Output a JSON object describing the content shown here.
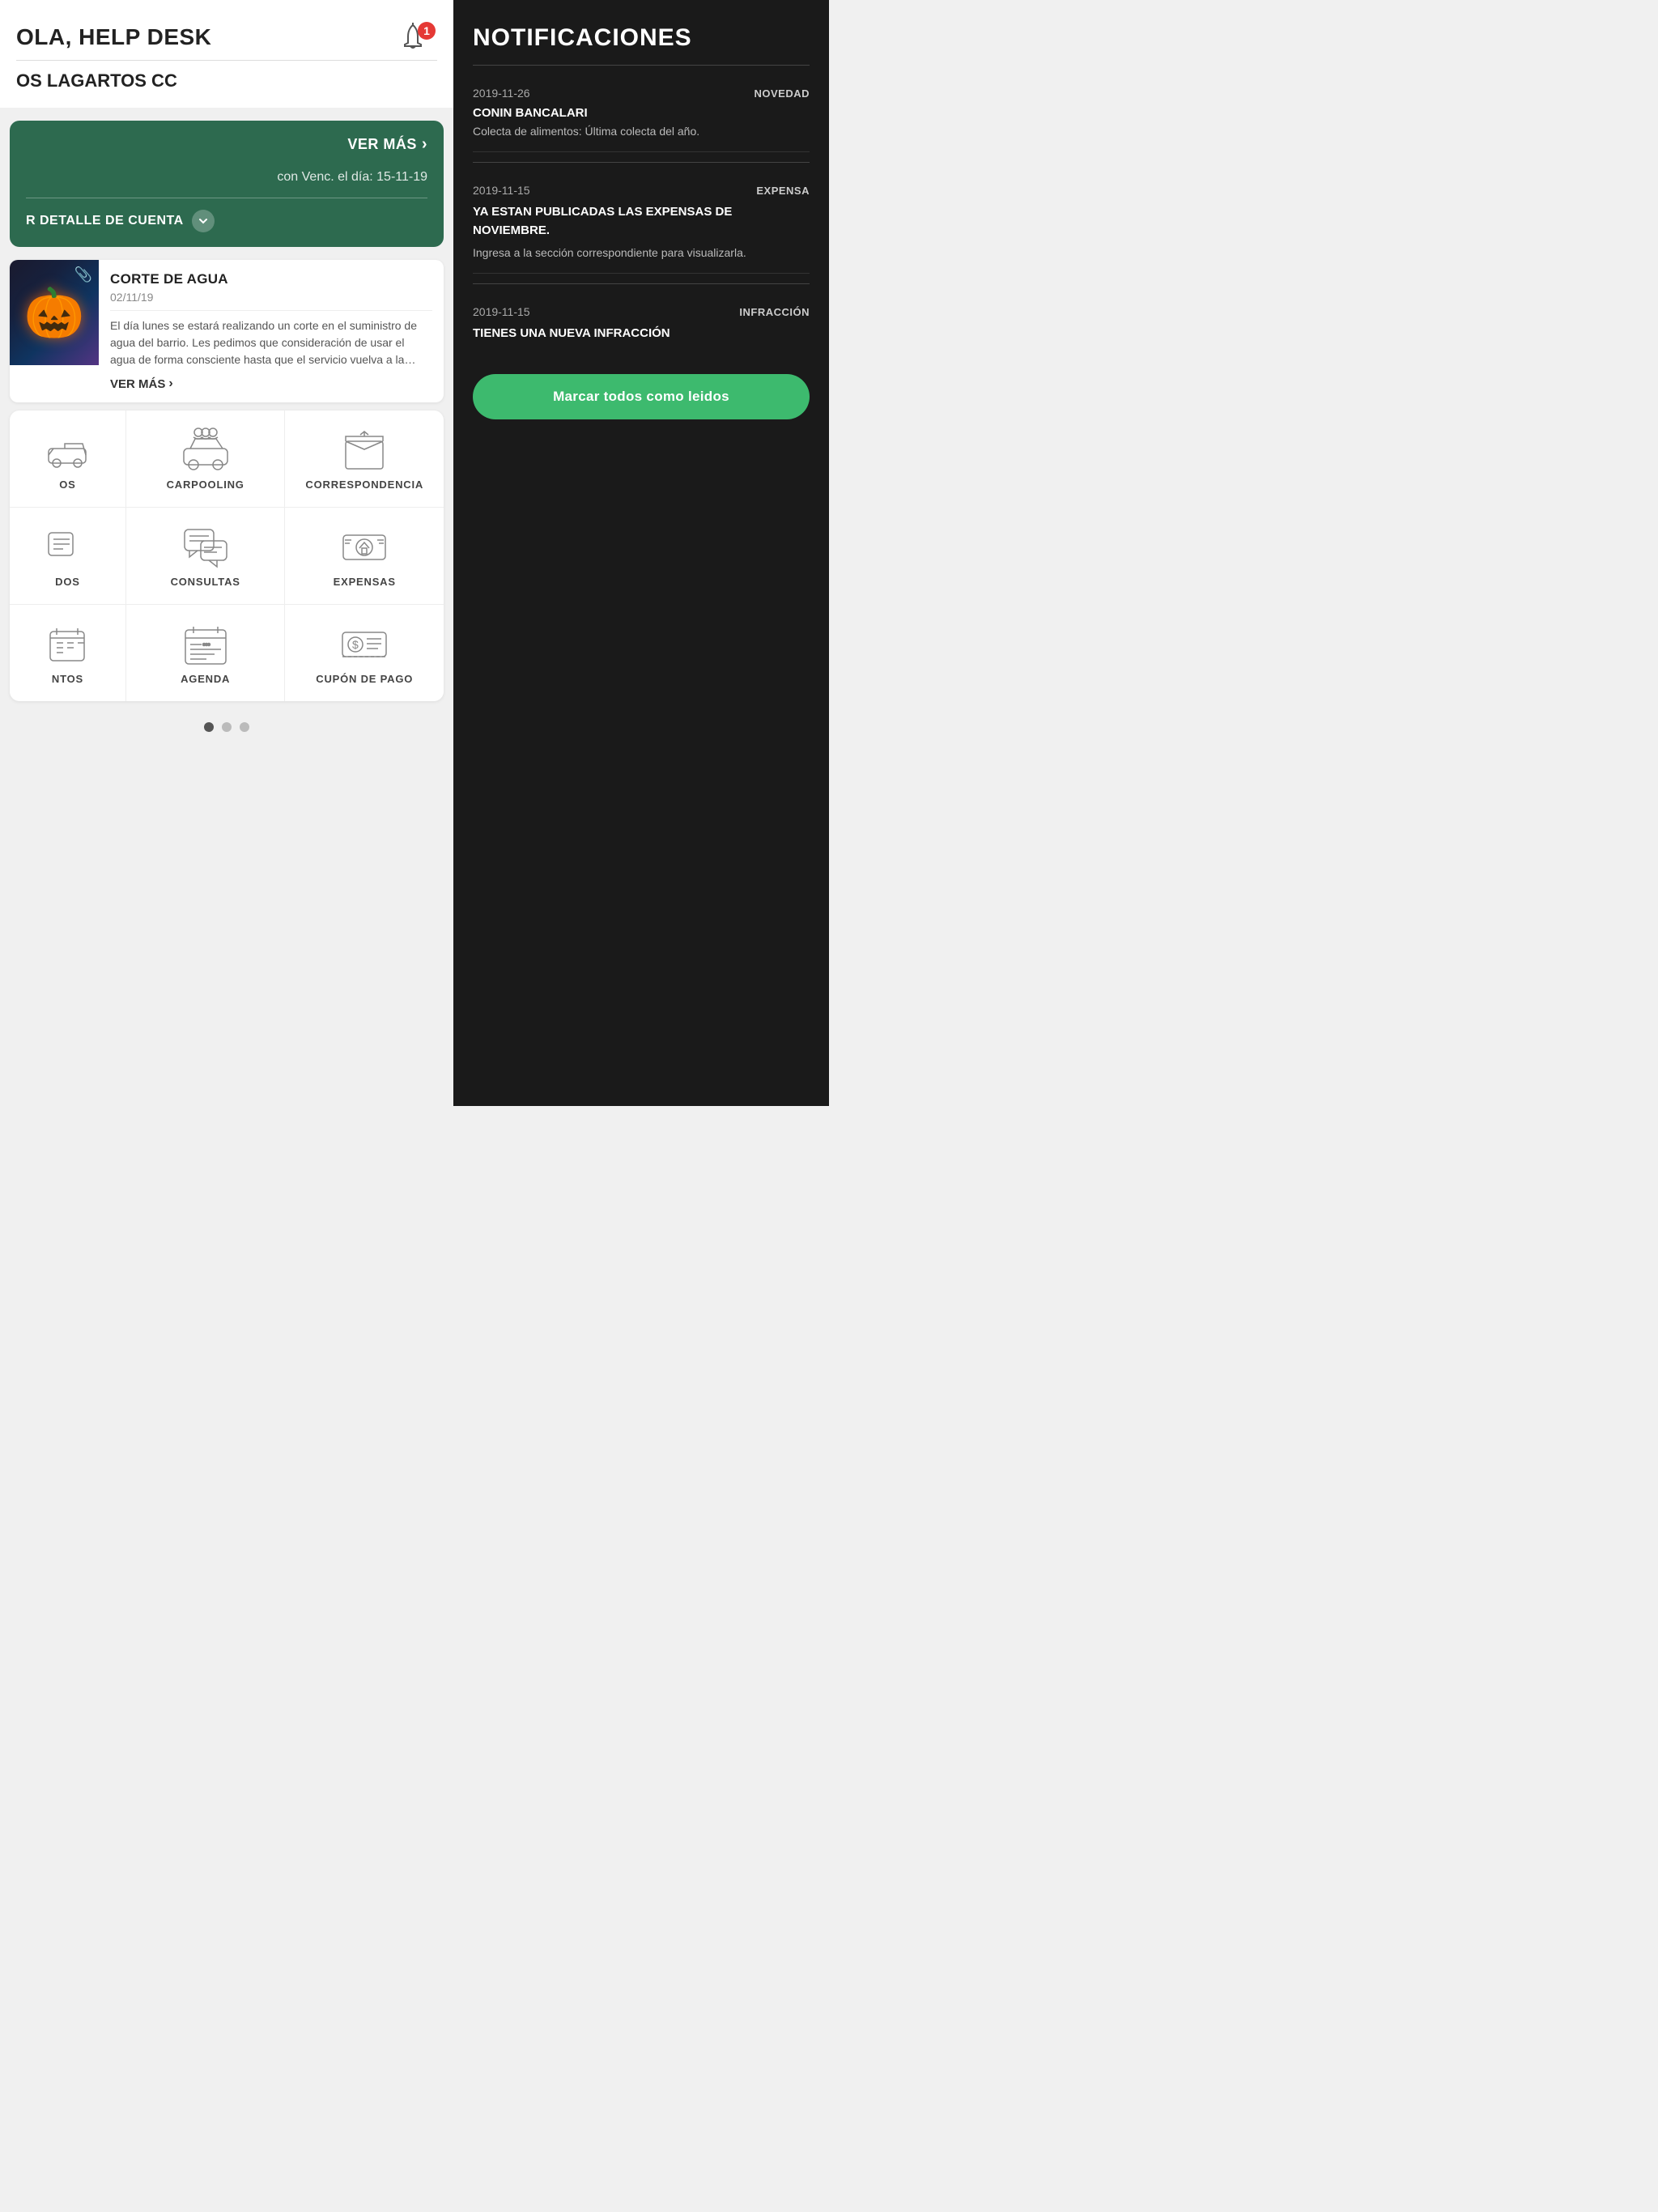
{
  "header": {
    "title": "OLA, HELP DESK",
    "subtitle": "OS LAGARTOS CC",
    "bell_badge": "1"
  },
  "green_card": {
    "ver_mas": "VER MÁS",
    "vencimiento": "con Venc. el día: 15-11-19",
    "detalle": "R DETALLE DE CUENTA"
  },
  "news_card": {
    "title": "CORTE DE AGUA",
    "date": "02/11/19",
    "text": "El día lunes se estará realizando un corte en el suministro de agua del barrio. Les pedimos que consideración de usar el agua de forma consciente hasta que el servicio vuelva a la normalidad.",
    "ver_mas": "VER MÁS"
  },
  "grid": {
    "rows": [
      {
        "cells": [
          {
            "id": "partial-left-1",
            "label": "OS",
            "partial": true
          },
          {
            "id": "carpooling",
            "label": "CARPOOLING"
          },
          {
            "id": "correspondencia",
            "label": "CORRESPONDENCIA"
          }
        ]
      },
      {
        "cells": [
          {
            "id": "partial-left-2",
            "label": "DOS",
            "partial": true
          },
          {
            "id": "consultas",
            "label": "CONSULTAS"
          },
          {
            "id": "expensas",
            "label": "EXPENSAS"
          }
        ]
      },
      {
        "cells": [
          {
            "id": "partial-left-3",
            "label": "NTOS",
            "partial": true
          },
          {
            "id": "agenda",
            "label": "AGENDA"
          },
          {
            "id": "cupon-pago",
            "label": "CUPÓN DE PAGO"
          }
        ]
      }
    ]
  },
  "pagination": {
    "dots": [
      {
        "active": true
      },
      {
        "active": false
      },
      {
        "active": false
      }
    ]
  },
  "notifications": {
    "title": "NOTIFICACIONES",
    "items": [
      {
        "date": "2019-11-26",
        "type": "NOVEDAD",
        "sender": "CONIN BANCALARI",
        "message": "Colecta de alimentos: Última colecta del año."
      },
      {
        "date": "2019-11-15",
        "type": "EXPENSA",
        "sender": "",
        "message": "YA ESTAN PUBLICADAS LAS EXPENSAS DE NOVIEMBRE.\nIngresa a la sección correspondiente para visualizarla."
      },
      {
        "date": "2019-11-15",
        "type": "INFRACCIÓN",
        "sender": "",
        "message": "TIENES UNA NUEVA INFRACCIÓN"
      }
    ],
    "mark_all_label": "Marcar todos como leidos"
  }
}
